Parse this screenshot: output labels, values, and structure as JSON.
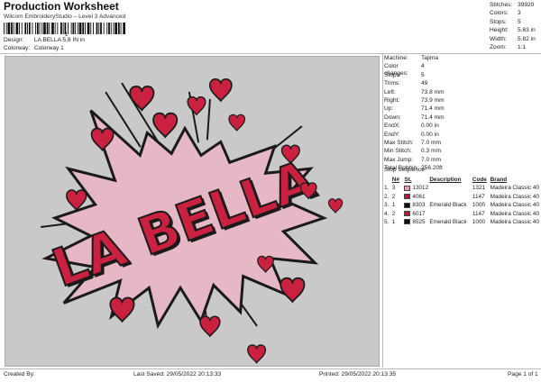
{
  "header": {
    "title": "Production Worksheet",
    "subtitle": "Wilcom EmbroideryStudio – Level 3 Advanced",
    "barcode_mark": "1"
  },
  "design_info": [
    {
      "label": "Design:",
      "value": "LA BELLA 5,8 IN in"
    },
    {
      "label": "Colorway:",
      "value": "Colorway 1"
    }
  ],
  "stats": [
    {
      "label": "Stitches:",
      "value": "39920"
    },
    {
      "label": "Colors:",
      "value": "3"
    },
    {
      "label": "Stops:",
      "value": "5"
    },
    {
      "label": "Height:",
      "value": "5.63 in"
    },
    {
      "label": "Width:",
      "value": "5.82 in"
    },
    {
      "label": "Zoom:",
      "value": "1:1"
    }
  ],
  "machine_info": [
    {
      "label": "Machine:",
      "value": "Tajima"
    },
    {
      "label": "Color changes:",
      "value": "4"
    },
    {
      "label": "Stops:",
      "value": "5"
    },
    {
      "label": "Trims:",
      "value": "49"
    },
    {
      "label": "Left:",
      "value": "73.8 mm"
    },
    {
      "label": "Right:",
      "value": "73.9 mm"
    },
    {
      "label": "Up:",
      "value": "71.4 mm"
    },
    {
      "label": "Down:",
      "value": "71.4 mm"
    },
    {
      "label": "EndX:",
      "value": "0.00 in"
    },
    {
      "label": "EndY:",
      "value": "0.00 in"
    },
    {
      "label": "Max Stitch:",
      "value": "7.0 mm"
    },
    {
      "label": "Min Stitch:",
      "value": "0.3 mm"
    },
    {
      "label": "Max Jump:",
      "value": "7.0 mm"
    },
    {
      "label": "Total Bobbin:",
      "value": "256.20ft"
    }
  ],
  "stop_sequence": {
    "title": "Stop Sequence:",
    "headers": [
      "N#",
      "St.",
      "Description",
      "Code",
      "Brand"
    ],
    "rows": [
      {
        "stop": "1.",
        "n": "3",
        "color": "#e8a3b5",
        "st": "13012",
        "description": "",
        "code": "1321",
        "brand": "Madeira Classic 40"
      },
      {
        "stop": "2.",
        "n": "2",
        "color": "#c0143c",
        "st": "4061",
        "description": "",
        "code": "1147",
        "brand": "Madeira Classic 40"
      },
      {
        "stop": "3.",
        "n": "1",
        "color": "#111111",
        "st": "8303",
        "description": "Emerald Black",
        "code": "1000",
        "brand": "Madeira Classic 40"
      },
      {
        "stop": "4.",
        "n": "2",
        "color": "#c0143c",
        "st": "6017",
        "description": "",
        "code": "1147",
        "brand": "Madeira Classic 40"
      },
      {
        "stop": "5.",
        "n": "1",
        "color": "#111111",
        "st": "8525",
        "description": "Emerald Black",
        "code": "1000",
        "brand": "Madeira Classic 40"
      }
    ]
  },
  "design_preview": {
    "text": "LA BELLA"
  },
  "footer": {
    "created_by": "Created By:",
    "last_saved": "Last Saved: 29/05/2022 20:13:33",
    "printed": "Printed: 29/05/2022 20:13:35",
    "page": "Page 1 of 1"
  }
}
